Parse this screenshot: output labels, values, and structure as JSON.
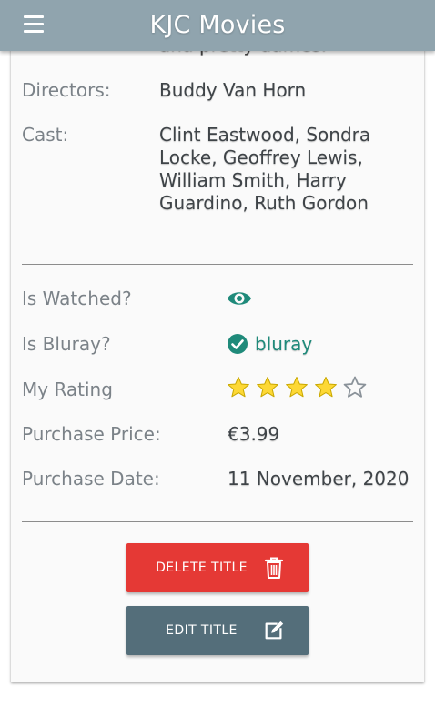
{
  "header": {
    "title": "KJC Movies",
    "menu_icon": "hamburger-menu-icon"
  },
  "details": {
    "cut_text": "and pretty dames.",
    "directors_label": "Directors:",
    "directors_value": "Buddy Van Horn",
    "cast_label": "Cast:",
    "cast_lines": [
      "Clint Eastwood, Sondra",
      "Locke, Geoffrey Lewis,",
      "William Smith, Harry",
      "Guardino, Ruth Gordon"
    ]
  },
  "status": {
    "watched_label": "Is Watched?",
    "watched_icon": "eye-icon",
    "bluray_label": "Is Bluray?",
    "bluray_icon": "check-circle-icon",
    "bluray_value": "bluray",
    "rating_label": "My Rating",
    "rating_value": 4,
    "rating_max": 5,
    "price_label": "Purchase Price:",
    "price_value": "€3.99",
    "date_label": "Purchase Date:",
    "date_value": "11 November, 2020"
  },
  "actions": {
    "delete_label": "DELETE TITLE",
    "delete_icon": "trash-icon",
    "edit_label": "EDIT TITLE",
    "edit_icon": "edit-icon"
  },
  "colors": {
    "header": "#90a4ae",
    "accent": "#1f8a7a",
    "star": "#fdd835",
    "delete": "#e53935",
    "edit": "#546e7a"
  }
}
